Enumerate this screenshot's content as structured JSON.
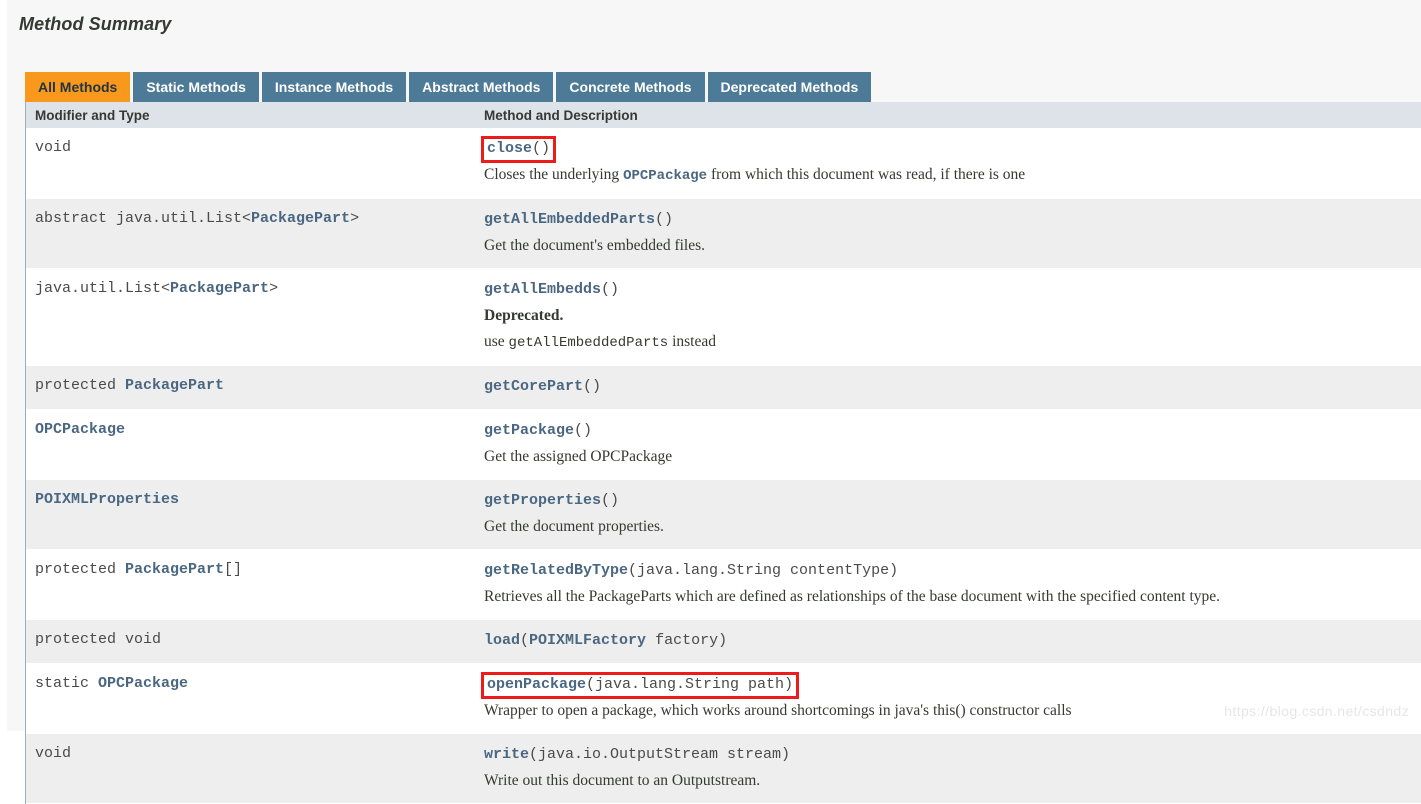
{
  "section": {
    "title": "Method Summary"
  },
  "tabs": [
    {
      "label": "All Methods",
      "active": true
    },
    {
      "label": "Static Methods",
      "active": false
    },
    {
      "label": "Instance Methods",
      "active": false
    },
    {
      "label": "Abstract Methods",
      "active": false
    },
    {
      "label": "Concrete Methods",
      "active": false
    },
    {
      "label": "Deprecated Methods",
      "active": false
    }
  ],
  "table": {
    "headers": {
      "modifier_and_type": "Modifier and Type",
      "method_and_description": "Method and Description"
    },
    "rows": [
      {
        "modifier_plain": "void",
        "modifier_link": "",
        "modifier_suffix": "",
        "method_name": "close",
        "method_params": "()",
        "highlight": true,
        "description_before": "Closes the underlying ",
        "description_link": "OPCPackage",
        "description_after": " from which this document was read, if there is one",
        "deprecated": ""
      },
      {
        "modifier_plain": "abstract java.util.List<",
        "modifier_link": "PackagePart",
        "modifier_suffix": ">",
        "method_name": "getAllEmbeddedParts",
        "method_params": "()",
        "highlight": false,
        "description_before": "Get the document's embedded files.",
        "description_link": "",
        "description_after": "",
        "deprecated": ""
      },
      {
        "modifier_plain": "java.util.List<",
        "modifier_link": "PackagePart",
        "modifier_suffix": ">",
        "method_name": "getAllEmbedds",
        "method_params": "()",
        "highlight": false,
        "deprecated": "Deprecated.",
        "description_before": "use ",
        "description_link_mono": "getAllEmbeddedParts",
        "description_after": " instead",
        "description_link": ""
      },
      {
        "modifier_plain": "protected ",
        "modifier_link": "PackagePart",
        "modifier_suffix": "",
        "method_name": "getCorePart",
        "method_params": "()",
        "highlight": false,
        "description_before": "",
        "description_link": "",
        "description_after": "",
        "deprecated": ""
      },
      {
        "modifier_plain": "",
        "modifier_link": "OPCPackage",
        "modifier_suffix": "",
        "method_name": "getPackage",
        "method_params": "()",
        "highlight": false,
        "description_before": "Get the assigned OPCPackage",
        "description_link": "",
        "description_after": "",
        "deprecated": ""
      },
      {
        "modifier_plain": "",
        "modifier_link": "POIXMLProperties",
        "modifier_suffix": "",
        "method_name": "getProperties",
        "method_params": "()",
        "highlight": false,
        "description_before": "Get the document properties.",
        "description_link": "",
        "description_after": "",
        "deprecated": ""
      },
      {
        "modifier_plain": "protected ",
        "modifier_link": "PackagePart",
        "modifier_suffix": "[]",
        "method_name": "getRelatedByType",
        "method_params": "(java.lang.String contentType)",
        "highlight": false,
        "description_before": "Retrieves all the PackageParts which are defined as relationships of the base document with the specified content type.",
        "description_link": "",
        "description_after": "",
        "deprecated": ""
      },
      {
        "modifier_plain": "protected void",
        "modifier_link": "",
        "modifier_suffix": "",
        "method_name": "load",
        "method_params_link": "POIXMLFactory",
        "method_params_pre": "(",
        "method_params_post": " factory)",
        "method_params": "",
        "highlight": false,
        "description_before": "",
        "description_link": "",
        "description_after": "",
        "deprecated": ""
      },
      {
        "modifier_plain": "static ",
        "modifier_link": "OPCPackage",
        "modifier_suffix": "",
        "method_name": "openPackage",
        "method_params": "(java.lang.String path)",
        "highlight": true,
        "description_before": "Wrapper to open a package, which works around shortcomings in java's this() constructor calls",
        "description_link": "",
        "description_after": "",
        "deprecated": ""
      },
      {
        "modifier_plain": "void",
        "modifier_link": "",
        "modifier_suffix": "",
        "method_name": "write",
        "method_params": "(java.io.OutputStream stream)",
        "highlight": false,
        "description_before": "Write out this document to an Outputstream.",
        "description_link": "",
        "description_after": "",
        "deprecated": ""
      }
    ]
  },
  "watermark": {
    "text": "https://blog.csdn.net/csdndz"
  },
  "colors": {
    "active_tab": "#f8981d",
    "inactive_tab": "#4d7a97",
    "header_row": "#dee3e9",
    "alt_row": "#eeeeee",
    "link_text": "#4a6782",
    "highlight_box": "#ee1b1b"
  }
}
